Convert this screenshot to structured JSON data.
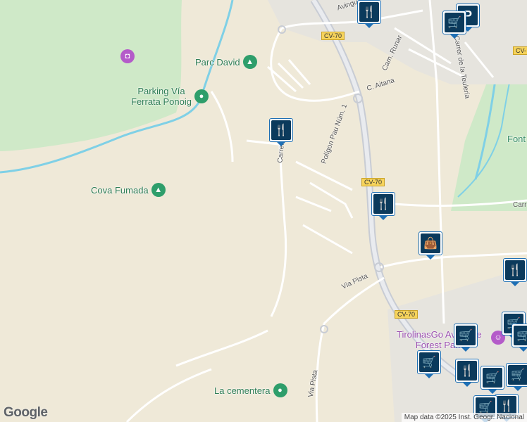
{
  "map": {
    "colors": {
      "land": "#efe9d8",
      "park": "#cfe9c8",
      "water": "#7fd0e6",
      "road": "#ffffff",
      "highway": "#c8ccd4",
      "marker_fill": "#0b3a5c",
      "marker_border": "#1e6fb4",
      "poi_green": "#2e9e6b",
      "poi_purple": "#b45bc9"
    },
    "pois": [
      {
        "label": "Parc David",
        "icon": "tree-icon"
      },
      {
        "label": "Parking Vía\nFerrata Ponoig",
        "icon": "pin-icon"
      },
      {
        "label": "Cova Fumada",
        "icon": "tree-icon"
      },
      {
        "label": "La cementera",
        "icon": "pin-icon"
      },
      {
        "label": "TirolinasGo Aventure\nForest Park",
        "icon": "amusement-icon"
      },
      {
        "label": "",
        "icon": "camera-icon"
      },
      {
        "label": "Font",
        "icon": "park-icon"
      }
    ],
    "roads": {
      "avinguda": "Avingu",
      "cam_runar": "Cam. Runar",
      "c_aitana": "C. Aitana",
      "carrer": "Carrer",
      "poligon": "Polígon Pau Núm. 1",
      "via_pista_1": "Via Pista",
      "via_pista_2": "Via Pista",
      "teuleria": "Carrer de la Teuleria",
      "carr": "Carr"
    },
    "shields": [
      "CV-70",
      "CV-70",
      "CV-70",
      "CV-"
    ],
    "markers": [
      "restaurant-icon",
      "restaurant-icon",
      "restaurant-icon",
      "restaurant-icon",
      "parking-icon",
      "shopping-cart-icon",
      "shopping-bag-icon",
      "shopping-cart-icon",
      "shopping-cart-icon",
      "shopping-cart-icon",
      "shopping-cart-icon",
      "shopping-cart-icon",
      "restaurant-icon",
      "shopping-cart-icon",
      "restaurant-icon",
      "shopping-cart-icon"
    ],
    "branding": "Google",
    "attribution": "Map data ©2025 Inst. Geogr. Nacional"
  }
}
